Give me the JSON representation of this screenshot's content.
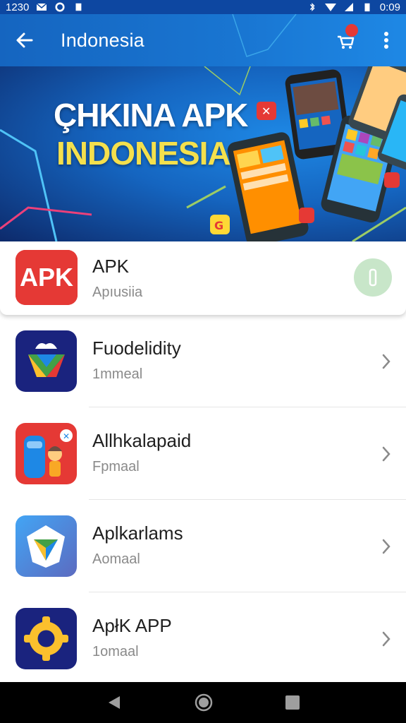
{
  "status_bar": {
    "time_left": "1230",
    "time_right": "0:09"
  },
  "app_bar": {
    "title": "Indonesia",
    "notification_count": ""
  },
  "banner": {
    "line1": "ÇHKINA APK",
    "line2": "INDONESIA"
  },
  "list": {
    "items": [
      {
        "title": "APK",
        "subtitle": "Apıusiia",
        "icon": "apk-logo-icon",
        "action": "toggle"
      },
      {
        "title": "Fuodelidity",
        "subtitle": "1mmeal",
        "icon": "play-store-style-icon",
        "action": "chevron"
      },
      {
        "title": "Allhkalapaid",
        "subtitle": "Fpmaal",
        "icon": "character-app-icon",
        "action": "chevron"
      },
      {
        "title": "Aplkarlams",
        "subtitle": "Aomaal",
        "icon": "diamond-shield-icon",
        "action": "chevron"
      },
      {
        "title": "ApłK APP",
        "subtitle": "1omaal",
        "icon": "gear-ring-icon",
        "action": "chevron"
      }
    ]
  },
  "colors": {
    "app_bar": "#1976d2",
    "status_bar": "#0d47a1",
    "banner_yellow": "#f4e04d",
    "toggle_bg": "#c8e6c9"
  }
}
